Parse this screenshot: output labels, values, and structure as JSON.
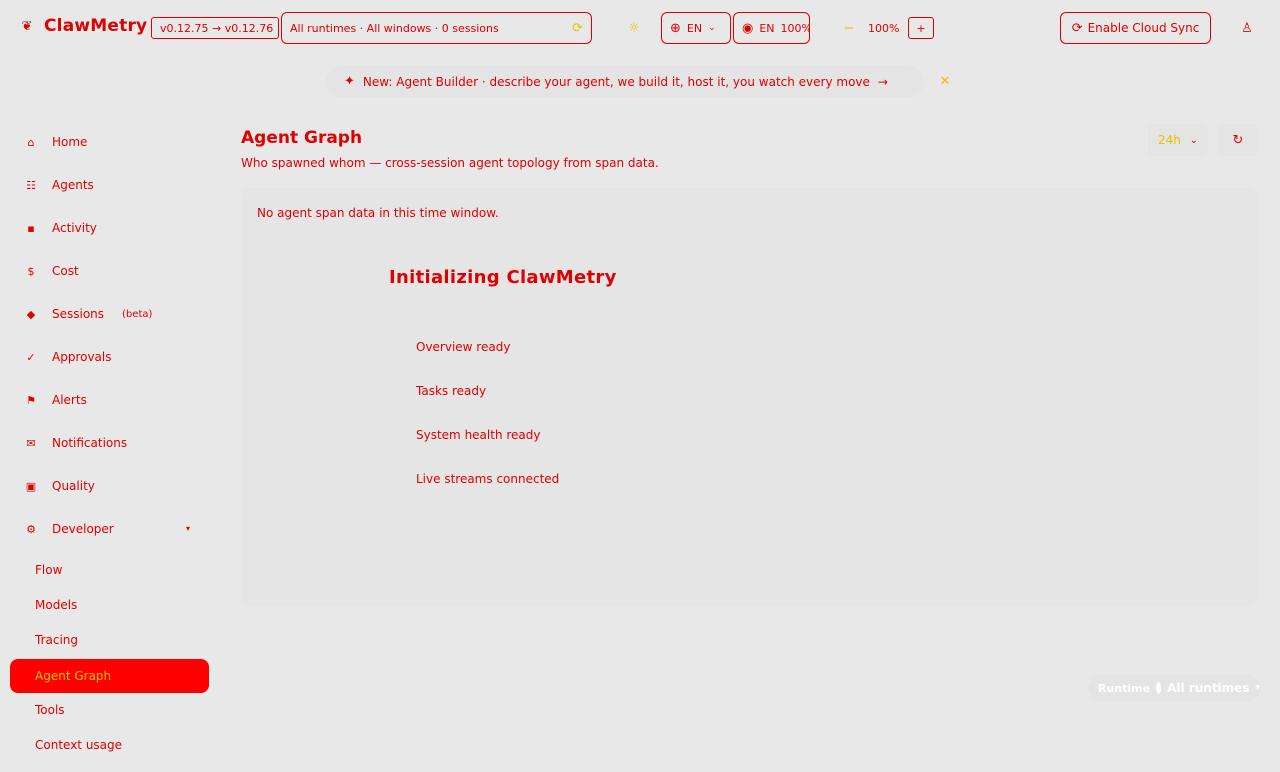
{
  "brand": {
    "name": "ClawMetry",
    "logo_icon": "❦"
  },
  "header": {
    "version": "v0.12.75 → v0.12.76",
    "runtime_selector": "All runtimes · All windows · 0 sessions",
    "theme_icon": "⟳",
    "activity_icon": "☼",
    "language_code": "EN",
    "language_flag": "EN",
    "zoom_minus_label": "100%",
    "zoom_value": "100%",
    "zoom_plus": "+",
    "cloud_sync_label": "Enable Cloud Sync"
  },
  "banner": {
    "icon": "✦",
    "text": "New: Agent Builder · describe your agent, we build it, host it, you watch every move",
    "arrow": "→",
    "close": "✕"
  },
  "sidebar": {
    "items": [
      {
        "label": "Home",
        "icon": "⌂"
      },
      {
        "label": "Agents",
        "icon": "☷"
      },
      {
        "label": "Activity",
        "icon": "▪"
      },
      {
        "label": "Cost",
        "icon": "$"
      },
      {
        "label": "Sessions",
        "icon": "◆",
        "badge": "(beta)"
      },
      {
        "label": "Approvals",
        "icon": "✓"
      },
      {
        "label": "Alerts",
        "icon": "⚑"
      },
      {
        "label": "Notifications",
        "icon": "✉"
      },
      {
        "label": "Quality",
        "icon": "▣"
      },
      {
        "label": "Developer",
        "icon": "⚙",
        "caret": "▾"
      }
    ],
    "developer_sub": [
      {
        "label": "Flow"
      },
      {
        "label": "Models"
      },
      {
        "label": "Tracing"
      },
      {
        "label": "Agent Graph"
      },
      {
        "label": "Tools"
      },
      {
        "label": "Context usage"
      }
    ]
  },
  "main": {
    "title": "Agent Graph",
    "subtitle": "Who spawned whom — cross-session agent topology from span data.",
    "range": "24h",
    "range_caret": "⌄",
    "refresh_icon": "↻",
    "empty_message": "No agent span data in this time window.",
    "init_title": "Initializing ClawMetry",
    "steps": [
      "Overview ready",
      "Tasks ready",
      "System health ready",
      "Live streams connected"
    ]
  },
  "runtime_pill": {
    "label": "Runtime",
    "value": "All runtimes",
    "caret": "▾"
  }
}
